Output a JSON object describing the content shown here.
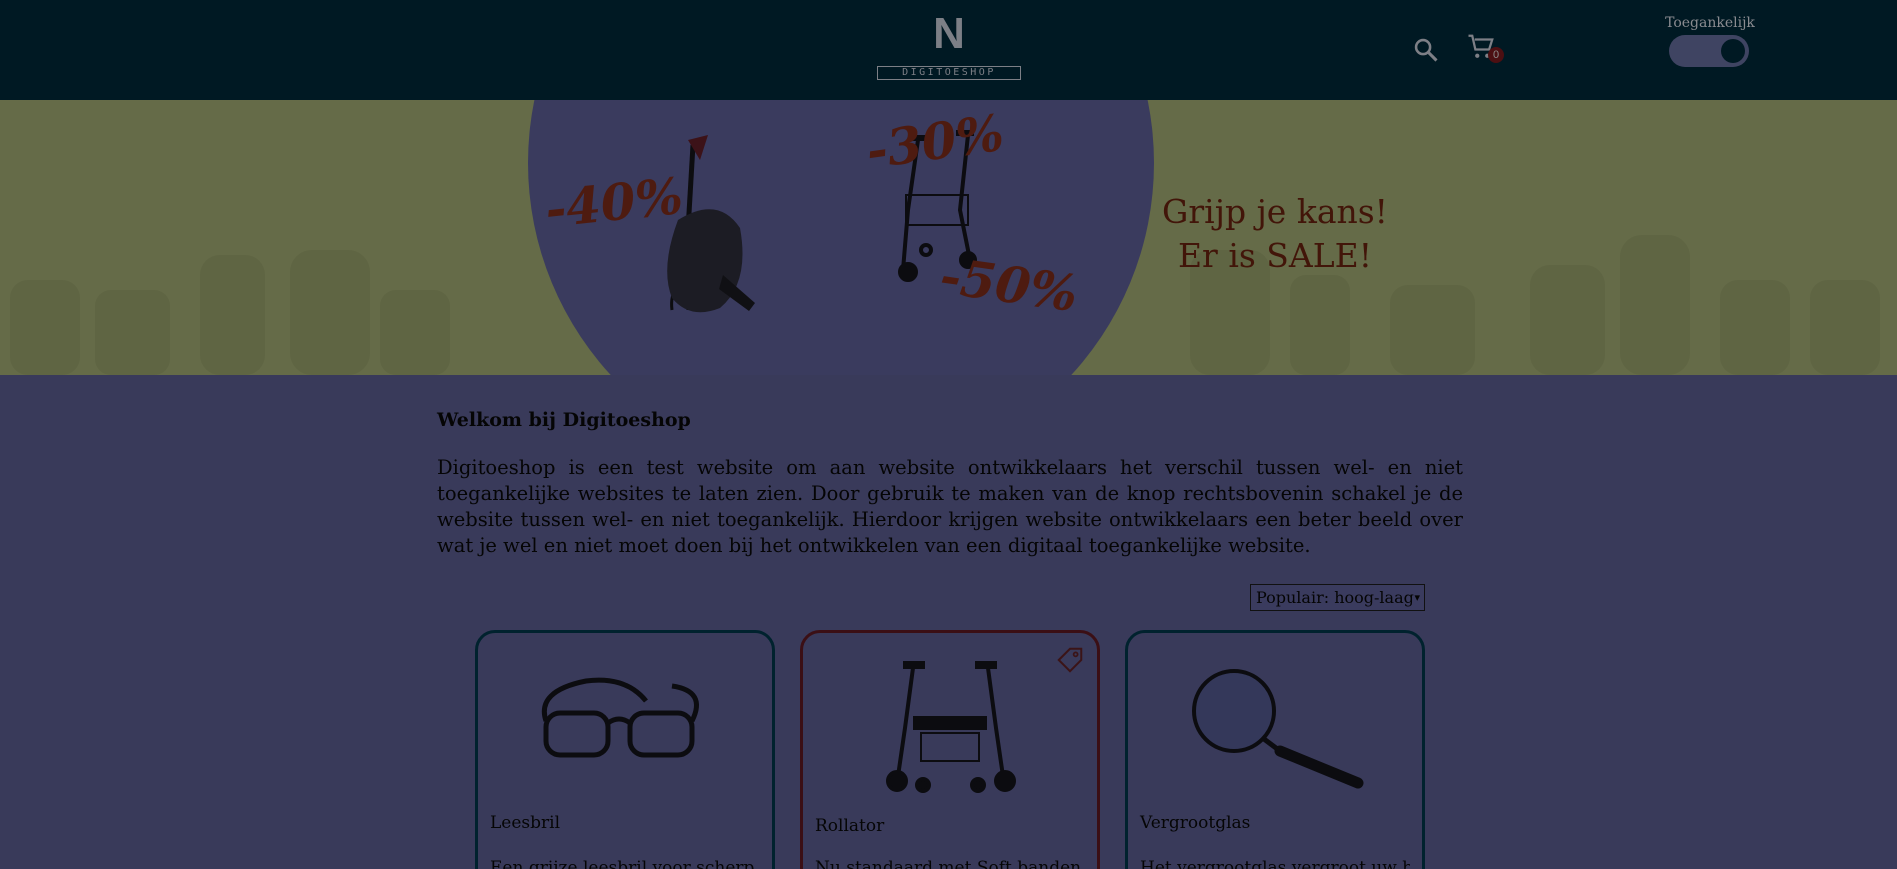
{
  "header": {
    "logo_mark": "N",
    "logo_word": "DIGITOESHOP",
    "search_icon": "search-icon",
    "cart_icon": "cart-icon",
    "cart_count": "0",
    "toggle_label": "Toegankelijk",
    "toggle_on": true
  },
  "banner": {
    "discounts": [
      "-40%",
      "-30%",
      "-50%"
    ],
    "promo_line1": "Grijp je kans!",
    "promo_line2": "Er is SALE!"
  },
  "main": {
    "welcome_title": "Welkom bij Digitoeshop",
    "intro": "Digitoeshop is een test website om aan website ontwikkelaars het verschil tussen wel- en niet toegankelijke websites te laten zien. Door gebruik te maken van de knop rechtsbovenin schakel je de website tussen wel- en niet toegankelijk. Hierdoor krijgen website ontwikkelaars een beter beeld over wat je wel en niet moet doen bij het ontwikkelen van een digitaal toegankelijke website.",
    "sort_selected": "Populair: hoog-laag"
  },
  "products": [
    {
      "title": "Leesbril",
      "desc": "Een grijze leesbril voor scherp...",
      "sale": false
    },
    {
      "title": "Rollator",
      "desc": "Nu standaard met Soft banden...",
      "sale": true
    },
    {
      "title": "Vergrootglas",
      "desc": "Het vergrootglas vergroot uw beeld...",
      "sale": false
    }
  ],
  "colors": {
    "header_bg": "#001923",
    "page_bg": "#393a5a",
    "banner_bg": "#656b48",
    "sale_accent": "#4e1b10"
  }
}
